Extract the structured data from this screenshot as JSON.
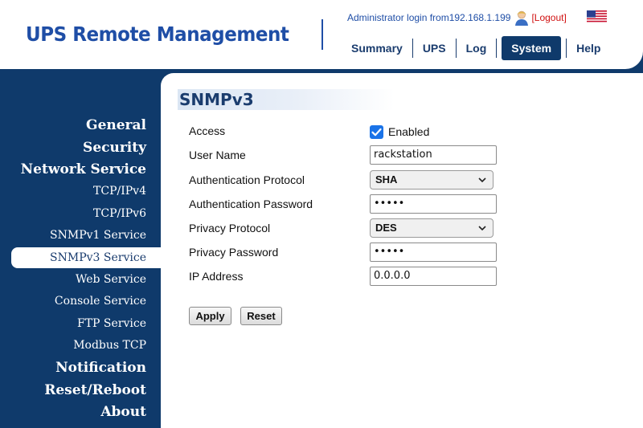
{
  "header": {
    "brand": "UPS Remote Management",
    "login_text": "Administrator login from192.168.1.199",
    "logout_label": "[Logout]",
    "nav": [
      "Summary",
      "UPS",
      "Log",
      "System",
      "Help"
    ],
    "active_nav": "System"
  },
  "sidebar": {
    "items": [
      {
        "label": "General",
        "kind": "major"
      },
      {
        "label": "Security",
        "kind": "major"
      },
      {
        "label": "Network Service",
        "kind": "major"
      },
      {
        "label": "TCP/IPv4",
        "kind": "minor"
      },
      {
        "label": "TCP/IPv6",
        "kind": "minor"
      },
      {
        "label": "SNMPv1 Service",
        "kind": "minor"
      },
      {
        "label": "SNMPv3 Service",
        "kind": "minor",
        "selected": true
      },
      {
        "label": "Web Service",
        "kind": "minor"
      },
      {
        "label": "Console Service",
        "kind": "minor"
      },
      {
        "label": "FTP Service",
        "kind": "minor"
      },
      {
        "label": "Modbus TCP",
        "kind": "minor"
      },
      {
        "label": "Notification",
        "kind": "major"
      },
      {
        "label": "Reset/Reboot",
        "kind": "major"
      },
      {
        "label": "About",
        "kind": "major"
      }
    ]
  },
  "form": {
    "title": "SNMPv3",
    "access": {
      "label": "Access",
      "checked": true,
      "option_label": "Enabled"
    },
    "user_name": {
      "label": "User Name",
      "value": "rackstation"
    },
    "auth_protocol": {
      "label": "Authentication Protocol",
      "value": "SHA"
    },
    "auth_password": {
      "label": "Authentication Password",
      "value": "•••••"
    },
    "privacy_protocol": {
      "label": "Privacy Protocol",
      "value": "DES"
    },
    "privacy_password": {
      "label": "Privacy Password",
      "value": "•••••"
    },
    "ip_address": {
      "label": "IP Address",
      "value": "0.0.0.0"
    },
    "apply_label": "Apply",
    "reset_label": "Reset"
  },
  "colors": {
    "navy": "#0f3a6b",
    "brand_blue": "#1f4ea6",
    "logout_red": "#d01010",
    "checkbox_blue": "#1a73e8"
  },
  "icons": [
    "user-icon",
    "us-flag-icon",
    "chevron-down-icon",
    "checkmark-icon"
  ]
}
